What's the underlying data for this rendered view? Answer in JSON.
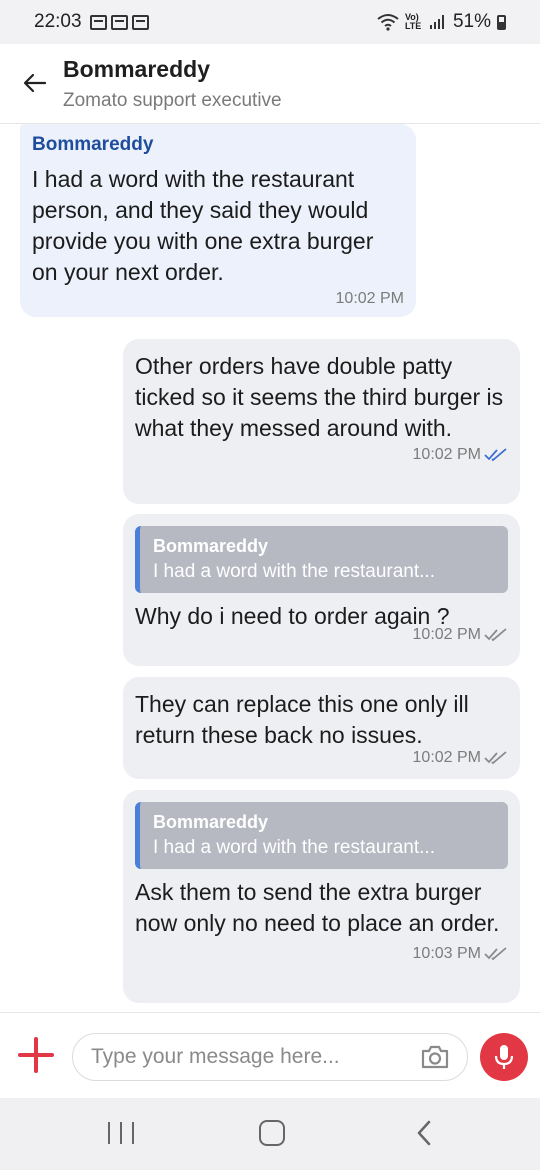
{
  "status_bar": {
    "time": "22:03",
    "network": "Vo) LTE",
    "battery": "51%",
    "icons": [
      "gallery-icon",
      "notification-icon",
      "notification-icon",
      "wifi-icon",
      "signal-icon",
      "battery-icon"
    ]
  },
  "header": {
    "title": "Bommareddy",
    "subtitle": "Zomato support executive",
    "back_icon": "arrow-left-icon"
  },
  "messages": [
    {
      "direction": "incoming",
      "sender": "Bommareddy",
      "text": "I had a word with the restaurant person, and they said they would provide you with one extra burger on your next order.",
      "time": "10:02 PM"
    },
    {
      "direction": "outgoing",
      "text": "Other orders have double patty ticked so it seems the third burger is what they messed around with.",
      "time": "10:02 PM",
      "status": "read"
    },
    {
      "direction": "outgoing",
      "quote": {
        "name": "Bommareddy",
        "text": "I had a word with the restaurant..."
      },
      "text": "Why do i need to order again ?",
      "time": "10:02 PM",
      "status": "delivered"
    },
    {
      "direction": "outgoing",
      "text": "They can replace this one only ill return these back no issues.",
      "time": "10:02 PM",
      "status": "delivered"
    },
    {
      "direction": "outgoing",
      "quote": {
        "name": "Bommareddy",
        "text": "I had a word with the restaurant..."
      },
      "text": "Ask them to send the extra burger now only no need to place an order.",
      "time": "10:03 PM",
      "status": "delivered"
    }
  ],
  "composer": {
    "placeholder": "Type your message here...",
    "value": ""
  },
  "colors": {
    "accent": "#e23744",
    "sender_name": "#1f4d9e",
    "incoming_bubble": "#ecf1fb",
    "outgoing_bubble": "#eeeff2",
    "quote_bg": "#b6b8c2",
    "quote_bar": "#4c7fd9",
    "read_tick": "#3d6fd1",
    "delivered_tick": "#8a8a8a"
  }
}
